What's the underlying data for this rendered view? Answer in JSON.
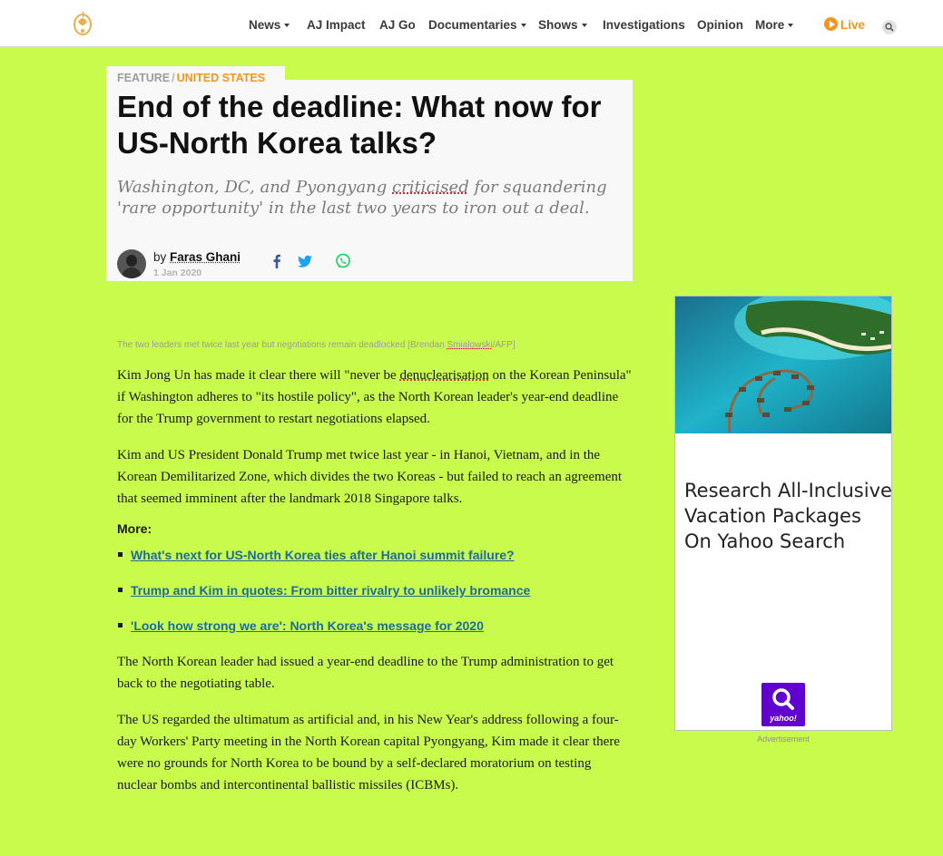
{
  "nav": {
    "items": [
      {
        "label": "News",
        "dropdown": true
      },
      {
        "label": "AJ Impact",
        "dropdown": false
      },
      {
        "label": "AJ Go",
        "dropdown": false
      },
      {
        "label": "Documentaries",
        "dropdown": true
      },
      {
        "label": "Shows",
        "dropdown": true
      },
      {
        "label": "Investigations",
        "dropdown": false
      },
      {
        "label": "Opinion",
        "dropdown": false
      },
      {
        "label": "More",
        "dropdown": true
      }
    ],
    "live_label": "Live"
  },
  "article": {
    "kicker_type": "FEATURE",
    "kicker_separator": "/",
    "kicker_topic": "UNITED STATES",
    "title": "End of the deadline: What now for US-North Korea talks?",
    "subtitle_a": "Washington, DC, and Pyongyang ",
    "subtitle_b": "criticised",
    "subtitle_c": " for squandering 'rare opportunity' in the last two years to iron out a deal.",
    "by": "by",
    "author": "Faras Ghani",
    "date": "1 Jan 2020",
    "caption_a": "The two leaders met twice last year but negotiations remain deadlocked [Brendan ",
    "caption_b": "Smialowski",
    "caption_c": "/AFP]",
    "p1_a": "Kim Jong Un has made it clear there will \"never be ",
    "p1_b": "denuclearisation",
    "p1_c": " on the Korean Peninsula\" if Washington adheres to \"its hostile policy\", as the North Korean leader's year-end deadline for the Trump government to restart negotiations elapsed.",
    "p2": "Kim and US President Donald Trump met twice last year - in Hanoi, Vietnam, and in the Korean Demilitarized Zone, which divides the two Koreas - but failed to reach an agreement that seemed imminent after the landmark 2018 Singapore talks.",
    "more_label": "More:",
    "more_links": [
      "What's next for US-North Korea ties after Hanoi summit failure?",
      "Trump and Kim in quotes: From bitter rivalry to unlikely bromance",
      "'Look how strong we are': North Korea's message for 2020"
    ],
    "p3": "The North Korean leader had issued a year-end deadline to the Trump administration to get back to the negotiating table.",
    "p4": "The US regarded the ultimatum as artificial and, in his New Year's address following a four-day Workers' Party meeting in the North Korean capital Pyongyang, Kim made it clear there were no grounds for North Korea to be bound by a self-declared moratorium on testing nuclear bombs and intercontinental ballistic missiles (ICBMs)."
  },
  "ad": {
    "headline": "Research All-Inclusive\nVacation Packages\nOn Yahoo Search",
    "logo_text": "yahoo!",
    "label": "Advertisement"
  },
  "colors": {
    "page_background": "#c9fb4d",
    "accent_orange": "#f7941e",
    "link_blue": "#1e6b9a",
    "yahoo_purple": "#6001d2"
  },
  "icons": [
    "aljazeera-logo-icon",
    "play-icon",
    "search-icon",
    "facebook-icon",
    "twitter-icon",
    "whatsapp-icon"
  ]
}
